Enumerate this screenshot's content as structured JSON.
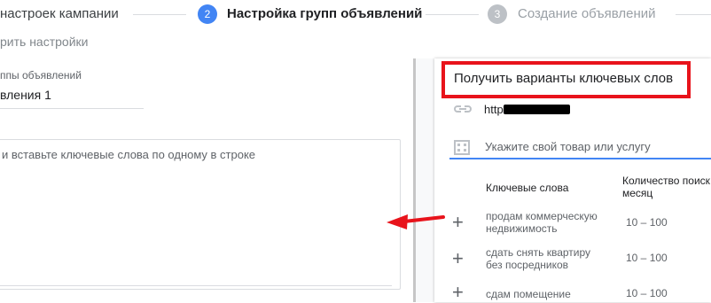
{
  "stepper": {
    "steps": [
      {
        "label": "настроек кампании",
        "state": "done"
      },
      {
        "number": "2",
        "label": "Настройка групп объявлений",
        "state": "active"
      },
      {
        "number": "3",
        "label": "Создание объявлений",
        "state": "future"
      }
    ],
    "active_color": "#4285f4",
    "future_color": "#bdc1c6"
  },
  "subtitle": "рить настройки",
  "ad_group": {
    "name_label": "ппы объявлений",
    "name_value": "вления 1",
    "keywords_placeholder": "и вставьте ключевые слова по одному в строке"
  },
  "keyword_ideas": {
    "title": "Получить варианты ключевых слов",
    "url_visible": "http",
    "product_placeholder": "Укажите свой товар или услугу",
    "columns": [
      "Ключевые слова",
      "Количество поиск",
      "месяц"
    ],
    "rows": [
      {
        "keyword_line1": "продам коммерческую",
        "keyword_line2": "недвижимость",
        "volume": "10 – 100"
      },
      {
        "keyword_line1": "сдать снять квартиру",
        "keyword_line2": "без посредников",
        "volume": "10 – 100"
      },
      {
        "keyword_line1": "сдам помещение",
        "keyword_line2": "",
        "volume": "10 – 100"
      }
    ]
  },
  "annotations": {
    "highlight_color": "#e8131b",
    "arrow_color": "#e8131b"
  },
  "icons": [
    "link-icon",
    "store-icon",
    "plus-icon",
    "arrow-left-icon"
  ]
}
